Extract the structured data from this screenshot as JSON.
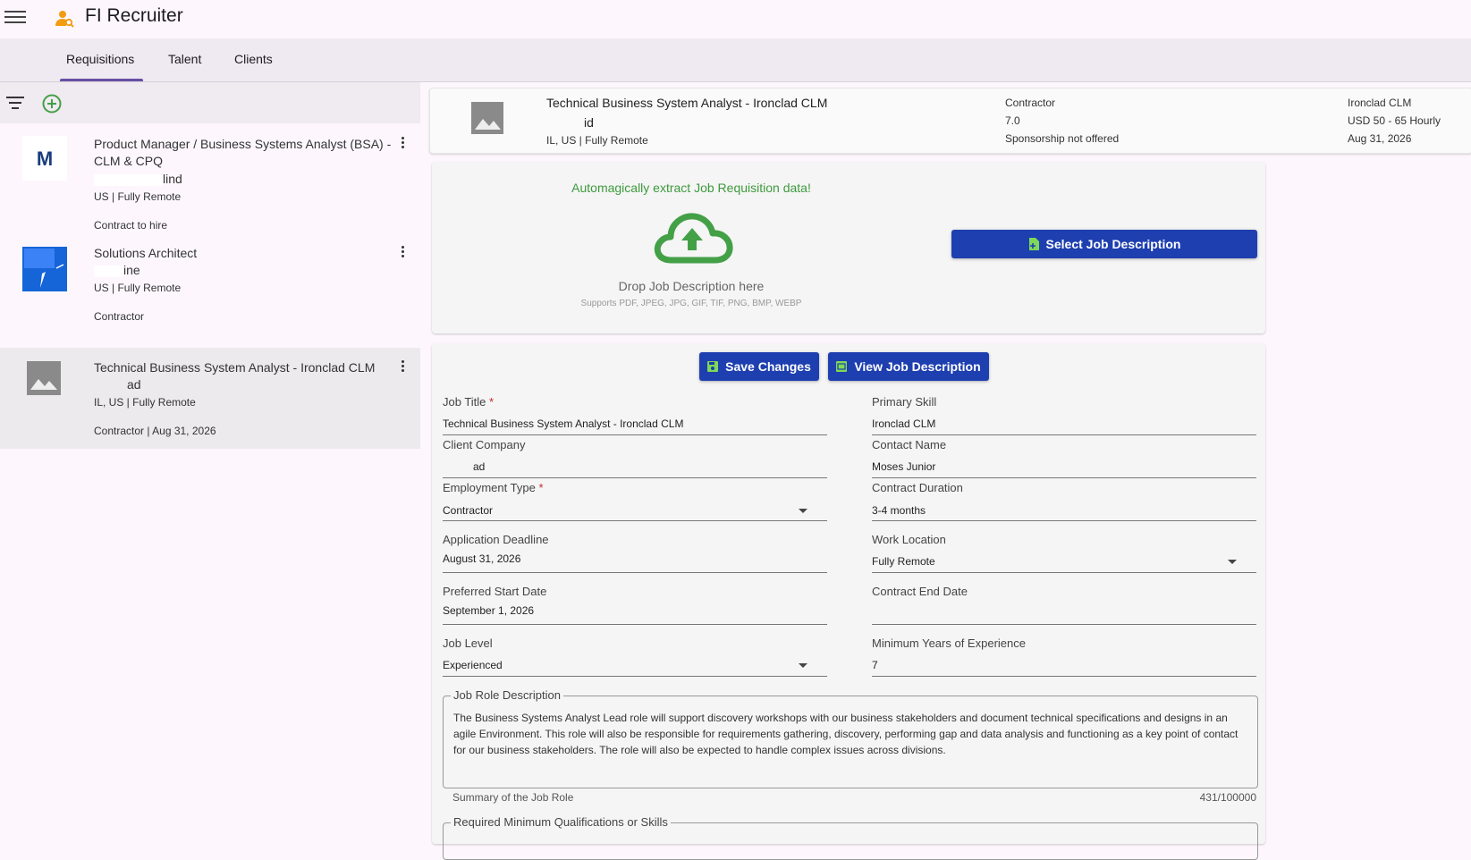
{
  "app": {
    "title": "FI Recruiter"
  },
  "tabs": [
    {
      "label": "Requisitions"
    },
    {
      "label": "Talent"
    },
    {
      "label": "Clients"
    }
  ],
  "requisitions": [
    {
      "title": "Product Manager / Business Systems Analyst (BSA) - CLM & CPQ",
      "company_visible": "lind",
      "location": "US | Fully Remote",
      "type": "Contract to hire"
    },
    {
      "title": "Solutions Architect",
      "company_visible": "ine",
      "location": "US | Fully Remote",
      "type": "Contractor"
    },
    {
      "title": "Technical Business System Analyst - Ironclad CLM",
      "company_visible": "ad",
      "location": "IL, US | Fully Remote",
      "type": "Contractor | Aug 31, 2026"
    }
  ],
  "header": {
    "title": "Technical Business System Analyst - Ironclad CLM",
    "company_visible": "id",
    "location": "IL, US | Fully Remote",
    "employment_type": "Contractor",
    "years": "7.0",
    "sponsorship": "Sponsorship not offered",
    "primary_skill": "Ironclad CLM",
    "rate": "USD 50 - 65 Hourly",
    "deadline": "Aug 31, 2026"
  },
  "upload": {
    "headline": "Automagically extract Job Requisition data!",
    "drop_text": "Drop Job Description here",
    "supports": "Supports PDF, JPEG, JPG, GIF, TIF, PNG, BMP, WEBP",
    "select_button": "Select Job Description"
  },
  "form": {
    "save_button": "Save Changes",
    "view_button": "View Job Description",
    "job_title": {
      "label": "Job Title",
      "required": "*",
      "value": "Technical Business System Analyst - Ironclad CLM"
    },
    "primary_skill": {
      "label": "Primary Skill",
      "value": "Ironclad CLM"
    },
    "client_company": {
      "label": "Client Company",
      "value": "ad"
    },
    "contact_name": {
      "label": "Contact Name",
      "value": "Moses Junior"
    },
    "employment_type": {
      "label": "Employment Type",
      "required": "*",
      "value": "Contractor"
    },
    "contract_duration": {
      "label": "Contract Duration",
      "value": "3-4 months"
    },
    "application_deadline": {
      "label": "Application Deadline",
      "value": "August 31, 2026"
    },
    "work_location": {
      "label": "Work Location",
      "value": "Fully Remote"
    },
    "preferred_start": {
      "label": "Preferred Start Date",
      "value": "September 1, 2026"
    },
    "contract_end": {
      "label": "Contract End Date",
      "value": ""
    },
    "job_level": {
      "label": "Job Level",
      "value": "Experienced"
    },
    "min_years": {
      "label": "Minimum Years of Experience",
      "value": "7"
    },
    "role_description": {
      "label": "Job Role Description",
      "value": "The Business Systems Analyst Lead role will support discovery workshops with our business stakeholders and document technical specifications and designs in an agile Environment. This role will also be responsible for requirements gathering, discovery, performing gap and data analysis and functioning as a key point of contact for our business stakeholders. The role will also be expected to handle complex issues across divisions.",
      "helper": "Summary of the Job Role",
      "counter": "431/100000"
    },
    "qualifications": {
      "label": "Required Minimum Qualifications or Skills"
    }
  },
  "colors": {
    "accent": "#1e3fb0",
    "tab_indicator": "#6750a4",
    "upload_green": "#3d9a3d",
    "add_green": "#43a047"
  }
}
